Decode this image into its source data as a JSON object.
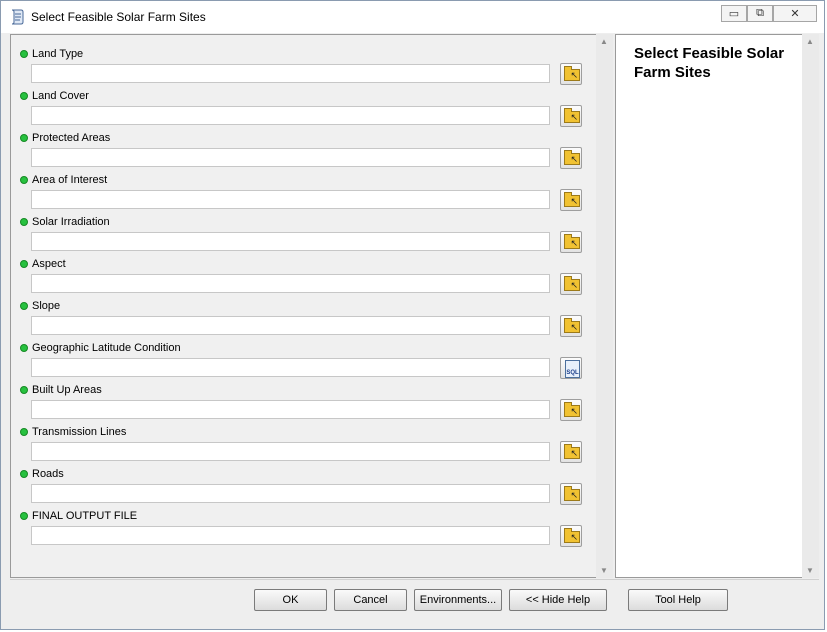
{
  "window": {
    "title": "Select Feasible Solar Farm Sites"
  },
  "window_controls": {
    "minimize": "▭",
    "restore": "⧉",
    "close": "✕"
  },
  "parameters": [
    {
      "label": "Land Type",
      "value": "",
      "button": "folder-browse"
    },
    {
      "label": "Land Cover",
      "value": "",
      "button": "folder-browse"
    },
    {
      "label": "Protected Areas",
      "value": "",
      "button": "folder-browse"
    },
    {
      "label": "Area of Interest",
      "value": "",
      "button": "folder-browse"
    },
    {
      "label": "Solar Irradiation",
      "value": "",
      "button": "folder-browse"
    },
    {
      "label": "Aspect",
      "value": "",
      "button": "folder-browse"
    },
    {
      "label": "Slope",
      "value": "",
      "button": "folder-browse"
    },
    {
      "label": "Geographic Latitude Condition",
      "value": "",
      "button": "sql-builder"
    },
    {
      "label": "Built Up Areas",
      "value": "",
      "button": "folder-browse"
    },
    {
      "label": "Transmission Lines",
      "value": "",
      "button": "folder-browse"
    },
    {
      "label": "Roads",
      "value": "",
      "button": "folder-browse"
    },
    {
      "label": "FINAL OUTPUT FILE",
      "value": "",
      "button": "folder-browse"
    }
  ],
  "sql_label": "SQL",
  "help_panel": {
    "title": "Select Feasible Solar Farm Sites"
  },
  "buttons": {
    "ok": "OK",
    "cancel": "Cancel",
    "environments": "Environments...",
    "hide_help": "<< Hide Help",
    "tool_help": "Tool Help"
  },
  "colors": {
    "required_dot": "#27c13f",
    "folder": "#f1c232"
  }
}
